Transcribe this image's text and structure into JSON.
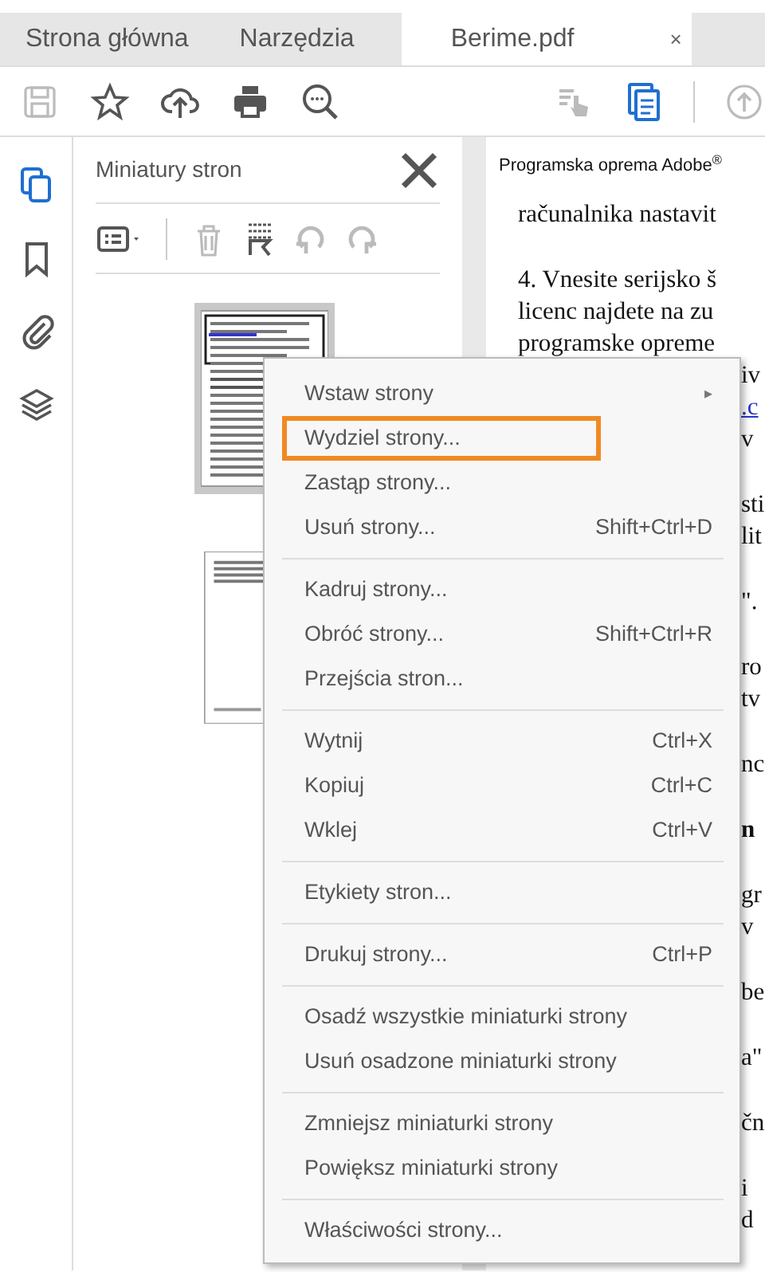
{
  "tabs": [
    {
      "label": "Strona główna",
      "kind": "nav",
      "selected": false
    },
    {
      "label": "Narzędzia",
      "kind": "nav",
      "selected": false
    },
    {
      "label": "Berime.pdf",
      "kind": "document",
      "selected": true,
      "close": "×"
    }
  ],
  "toolbar": {
    "items": [
      {
        "disabled": true,
        "selected": false
      },
      {
        "disabled": false,
        "selected": false
      },
      {
        "disabled": false,
        "selected": false
      },
      {
        "disabled": false,
        "selected": false
      },
      {
        "disabled": false,
        "selected": false
      },
      {
        "disabled": true,
        "selected": false
      },
      {
        "disabled": false,
        "selected": true
      },
      {
        "disabled": true,
        "selected": false
      }
    ]
  },
  "sidebar": {
    "items": [
      {
        "selected": true
      },
      {
        "selected": false
      },
      {
        "selected": false
      },
      {
        "selected": false
      }
    ]
  },
  "panel": {
    "title": "Miniatury stron",
    "tools": [
      {
        "disabled": false
      },
      {
        "disabled": true
      },
      {
        "disabled": false
      },
      {
        "disabled": true
      },
      {
        "disabled": true
      }
    ],
    "thumbnails": [
      {
        "kind": "picture",
        "selected": true
      },
      {
        "kind": "picture",
        "selected": false
      }
    ]
  },
  "document": {
    "header": "Programska oprema Adobe$^{®}$",
    "paragraphs": [
      {
        "lines": [
          {
            "text": "računalnika nastavit",
            "kind": "full"
          }
        ]
      },
      {
        "lines": [
          {
            "text": "4. Vnesite serijsko š",
            "kind": "full"
          },
          {
            "text": "licenc najdete na zu",
            "kind": "full"
          },
          {
            "text": "programske opreme",
            "kind": "full"
          },
          {
            "text": "iv",
            "kind": "fragment"
          },
          {
            "text": ".c",
            "kind": "link"
          },
          {
            "text": "v",
            "kind": "fragment"
          }
        ]
      },
      {
        "lines": [
          {
            "text": "sti",
            "kind": "fragment"
          },
          {
            "text": "lit",
            "kind": "fragment"
          }
        ]
      },
      {
        "lines": [
          {
            "text": "\".",
            "kind": "fragment"
          }
        ]
      },
      {
        "lines": [
          {
            "text": "ro",
            "kind": "fragment"
          },
          {
            "text": "tv",
            "kind": "fragment"
          }
        ]
      },
      {
        "lines": [
          {
            "text": "nc",
            "kind": "fragment"
          }
        ]
      },
      {
        "lines": [
          {
            "text": "n",
            "kind": "bold"
          }
        ]
      },
      {
        "lines": [
          {
            "text": "gr",
            "kind": "fragment"
          },
          {
            "text": "v",
            "kind": "fragment"
          }
        ]
      },
      {
        "lines": [
          {
            "text": "be",
            "kind": "fragment"
          }
        ]
      },
      {
        "lines": [
          {
            "text": "a\"",
            "kind": "fragment"
          }
        ]
      },
      {
        "lines": [
          {
            "text": "čn",
            "kind": "fragment"
          }
        ]
      },
      {
        "lines": [
          {
            "text": "i",
            "kind": "fragment"
          },
          {
            "text": "d",
            "kind": "fragment"
          }
        ]
      }
    ]
  },
  "context_menu": {
    "items": [
      {
        "kind": "item",
        "label": "Wstaw strony",
        "submenu": true,
        "submenu_mark": "▸",
        "highlighted": false
      },
      {
        "kind": "item",
        "label": "Wydziel strony...",
        "highlighted": true
      },
      {
        "kind": "item",
        "label": "Zastąp strony...",
        "highlighted": false
      },
      {
        "kind": "item",
        "label": "Usuń strony...",
        "shortcut": "Shift+Ctrl+D",
        "highlighted": false
      },
      {
        "kind": "separator"
      },
      {
        "kind": "item",
        "label": "Kadruj strony...",
        "highlighted": false
      },
      {
        "kind": "item",
        "label": "Obróć strony...",
        "shortcut": "Shift+Ctrl+R",
        "highlighted": false
      },
      {
        "kind": "item",
        "label": "Przejścia stron...",
        "highlighted": false
      },
      {
        "kind": "separator"
      },
      {
        "kind": "item",
        "label": "Wytnij",
        "shortcut": "Ctrl+X",
        "highlighted": false
      },
      {
        "kind": "item",
        "label": "Kopiuj",
        "shortcut": "Ctrl+C",
        "highlighted": false
      },
      {
        "kind": "item",
        "label": "Wklej",
        "shortcut": "Ctrl+V",
        "highlighted": false
      },
      {
        "kind": "separator"
      },
      {
        "kind": "item",
        "label": "Etykiety stron...",
        "highlighted": false
      },
      {
        "kind": "separator"
      },
      {
        "kind": "item",
        "label": "Drukuj strony...",
        "shortcut": "Ctrl+P",
        "highlighted": false
      },
      {
        "kind": "separator"
      },
      {
        "kind": "item",
        "label": "Osadź wszystkie miniaturki strony",
        "highlighted": false
      },
      {
        "kind": "item",
        "label": "Usuń osadzone miniaturki strony",
        "highlighted": false
      },
      {
        "kind": "separator"
      },
      {
        "kind": "item",
        "label": "Zmniejsz miniaturki strony",
        "highlighted": false
      },
      {
        "kind": "item",
        "label": "Powiększ miniaturki strony",
        "highlighted": false
      },
      {
        "kind": "separator"
      },
      {
        "kind": "item",
        "label": "Właściwości strony...",
        "highlighted": false
      }
    ]
  }
}
